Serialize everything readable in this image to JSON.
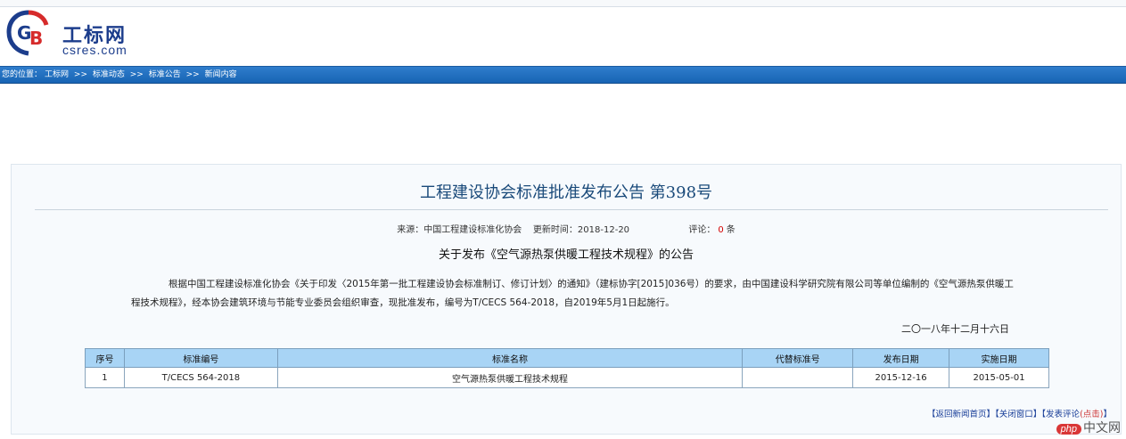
{
  "header": {
    "logo_text": "工标网",
    "logo_domain": "csres.com"
  },
  "breadcrumb": {
    "prefix": "您的位置：",
    "items": [
      "工标网",
      "标准动态",
      "标准公告",
      "新闻内容"
    ],
    "separator": ">>"
  },
  "article": {
    "title": "工程建设协会标准批准发布公告 第398号",
    "source_label": "来源：",
    "source": "中国工程建设标准化协会",
    "updated_label": "更新时间：",
    "updated": "2018-12-20",
    "comment_label": "评论：",
    "comment_count": "0",
    "comment_unit": "条",
    "subtitle": "关于发布《空气源热泵供暖工程技术规程》的公告",
    "body": "根据中国工程建设标准化协会《关于印发〈2015年第一批工程建设协会标准制订、修订计划〉的通知》（建标协字[2015]036号）的要求，由中国建设科学研究院有限公司等单位编制的《空气源热泵供暖工程技术规程》，经本协会建筑环境与节能专业委员会组织审查，现批准发布，编号为T/CECS 564-2018，自2019年5月1日起施行。",
    "date": "二〇一八年十二月十六日"
  },
  "table": {
    "headers": [
      "序号",
      "标准编号",
      "标准名称",
      "代替标准号",
      "发布日期",
      "实施日期"
    ],
    "rows": [
      [
        "1",
        "T/CECS 564-2018",
        "空气源热泵供暖工程技术规程",
        "",
        "2015-12-16",
        "2015-05-01"
      ]
    ]
  },
  "footer": {
    "back_link": "【返回新闻首页】",
    "close_link": "【关闭窗口】",
    "comment_open": "【发表评论",
    "comment_action": "(点击)",
    "comment_close": "】"
  },
  "watermark": {
    "badge": "php",
    "text": "中文网"
  },
  "colors": {
    "nav_bar": "#1764b4",
    "title": "#1a4a7a",
    "table_header": "#a8d4f5",
    "comment_count": "#d40000",
    "footer_link": "#1a3f99"
  }
}
